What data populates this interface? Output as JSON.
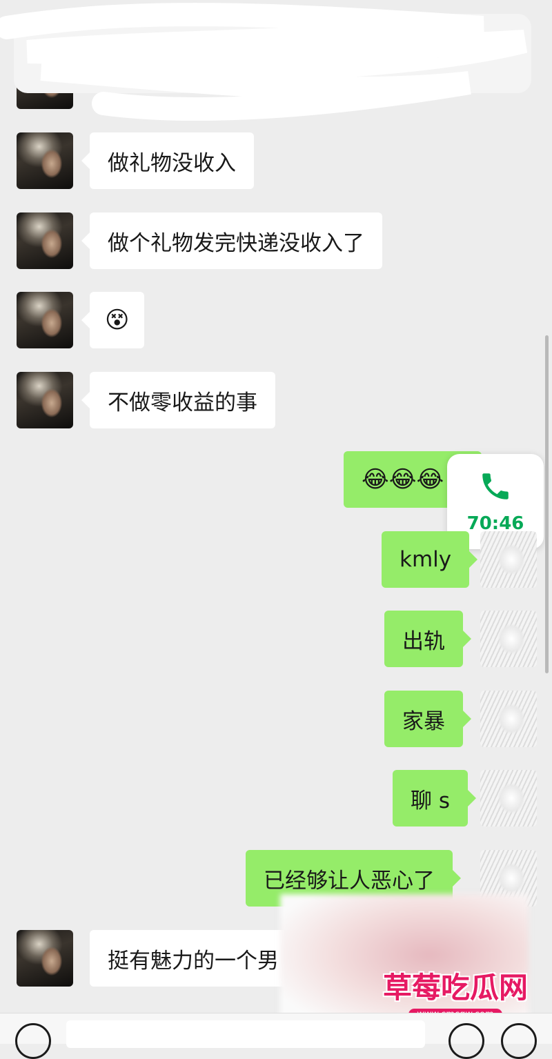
{
  "messages": [
    {
      "side": "in",
      "text": "做礼物没收入"
    },
    {
      "side": "in",
      "text": "做个礼物发完快递没收入了"
    },
    {
      "side": "in",
      "emoji": "dizzy-face",
      "text": "😵"
    },
    {
      "side": "in",
      "text": "不做零收益的事"
    },
    {
      "side": "out",
      "emoji": "crying-laughing",
      "text": "😂😂😂"
    },
    {
      "side": "out",
      "text": "kmly"
    },
    {
      "side": "out",
      "text": "出轨"
    },
    {
      "side": "out",
      "text": "家暴"
    },
    {
      "side": "out",
      "text": "聊 s"
    },
    {
      "side": "out",
      "text": "已经够让人恶心了"
    },
    {
      "side": "in",
      "text": "挺有魅力的一个男"
    }
  ],
  "call_float": {
    "duration": "70:46",
    "icon": "phone-icon",
    "color": "#07a957"
  },
  "watermark": {
    "title": "草莓吃瓜网",
    "url": "www.cmcgw.com"
  },
  "colors": {
    "incoming_bubble": "#ffffff",
    "outgoing_bubble": "#95ec69",
    "background": "#ededed"
  }
}
